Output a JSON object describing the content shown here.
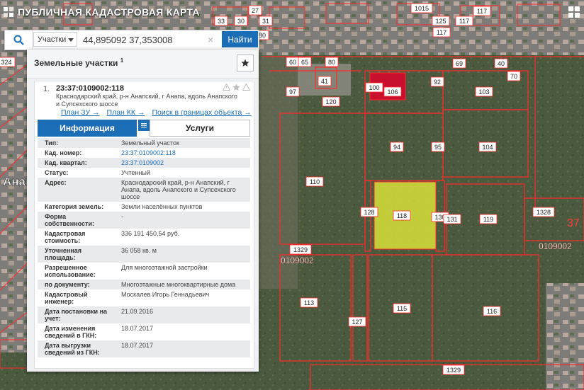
{
  "app": {
    "title": "ПУБЛИЧНАЯ КАДАСТРОВАЯ КАРТА"
  },
  "search": {
    "type_selected": "Участки",
    "query": "44,895092 37,353008",
    "find_label": "Найти"
  },
  "panel": {
    "title": "Земельные участки",
    "count": "1"
  },
  "result": {
    "index": "1.",
    "id": "23:37:0109002:118",
    "address": "Краснодарский край, р-н Анапский, г Анапа, вдоль Анапского и Супсехского шоссе",
    "links": [
      "План ЗУ →",
      "План КК →",
      "Поиск в границах объекта →"
    ],
    "tabs": [
      "Информация",
      "Услуги"
    ]
  },
  "info_rows": [
    {
      "label": "Тип:",
      "value": "Земельный участок"
    },
    {
      "label": "Кад. номер:",
      "value": "23:37:0109002:118"
    },
    {
      "label": "Кад. квартал:",
      "value": "23:37:0109002"
    },
    {
      "label": "Статус:",
      "value": "Учтенный"
    },
    {
      "label": "Адрес:",
      "value": "Краснодарский край, р-н Анапский, г Анапа, вдоль Анапского и Супсехского шоссе"
    },
    {
      "label": "Категория земель:",
      "value": "Земли населённых пунктов"
    },
    {
      "label": "Форма собственности:",
      "value": "-"
    },
    {
      "label": "Кадастровая стоимость:",
      "value": "336 191 450,54 руб."
    },
    {
      "label": "Уточненная площадь:",
      "value": "36 058 кв. м"
    },
    {
      "label": "Разрешенное использование:",
      "value": "Для многоэтажной застройки"
    },
    {
      "label": "по документу:",
      "value": "Многоэтажные многоквартирные дома"
    },
    {
      "label": "Кадастровый инженер:",
      "value": "Москалев Игорь Геннадьевич"
    },
    {
      "label": "Дата постановки на учет:",
      "value": "21.09.2016"
    },
    {
      "label": "Дата изменения сведений в ГКН:",
      "value": "18.07.2017"
    },
    {
      "label": "Дата выгрузки сведений из ГКН:",
      "value": "18.07.2017"
    }
  ],
  "map_labels": {
    "parcels": [
      "100",
      "106",
      "94",
      "92",
      "103",
      "104",
      "119",
      "110",
      "94",
      "95",
      "118",
      "128",
      "130",
      "131",
      "115",
      "113",
      "116",
      "127",
      "129",
      "97",
      "41",
      "120",
      "60",
      "40",
      "70",
      "69",
      "80",
      "65",
      "1328",
      "1329",
      "1329",
      "37",
      "324",
      "125",
      "117",
      "117",
      "117",
      "1015",
      "27",
      "30",
      "31",
      "80",
      "33",
      "115"
    ],
    "quarter_right": "0109002",
    "quarter_left": "0109002",
    "town": "Анап",
    "block_37": "37"
  },
  "colors": {
    "brand": "#1b6db5",
    "selected_parcel": "#d8e23a",
    "highlight_parcel": "#c8102e",
    "boundary": "#ff2a2a"
  }
}
